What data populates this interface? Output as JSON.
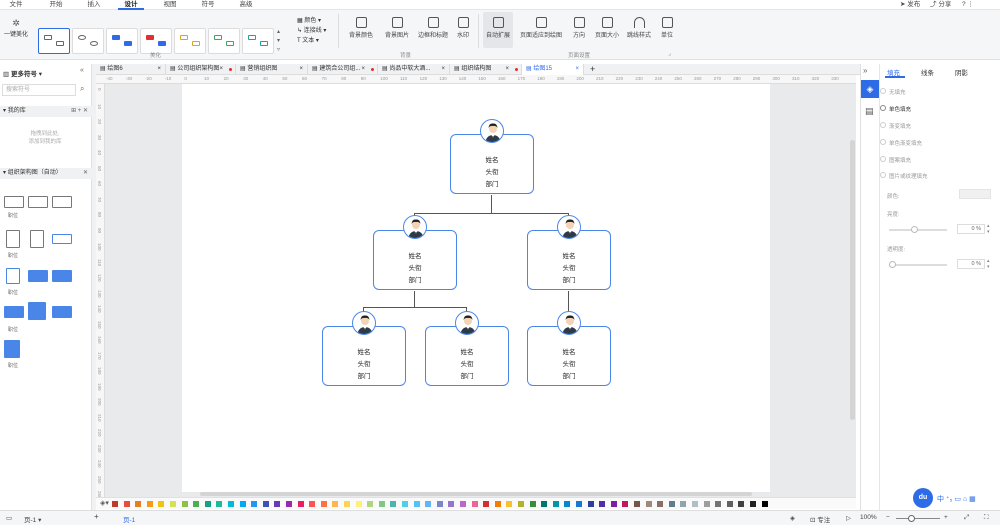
{
  "menubar": {
    "items": [
      "文件",
      "开始",
      "插入",
      "设计",
      "视图",
      "符号",
      "高级"
    ],
    "active_index": 3,
    "right": {
      "publish": "发布",
      "share": "分享",
      "help": "?"
    }
  },
  "ribbon": {
    "beautify_label": "一键美化",
    "group_beautify": "美化",
    "group_background": "背景",
    "group_page_setup": "页面设置",
    "color_label": "颜色",
    "connector_label": "连接线",
    "text_label": "文本",
    "buttons": [
      "背景颜色",
      "背景图片",
      "边框和标题",
      "水印",
      "自动扩展",
      "页面适应到绘图",
      "方向",
      "页面大小",
      "跳线样式",
      "单位"
    ]
  },
  "left_panel": {
    "title": "更多符号",
    "search_placeholder": "搜索符号",
    "my_library": "我的库",
    "drop_hint_line1": "拖拽到此处,",
    "drop_hint_line2": "添加到我的库",
    "org_section": "组织架构图（自动）",
    "shape_label": "职位"
  },
  "tabs": [
    {
      "label": "绘图6",
      "dot": false
    },
    {
      "label": "公司组织架构图",
      "dot": true
    },
    {
      "label": "营销组织图",
      "dot": false
    },
    {
      "label": "建筑合公司组...",
      "dot": true
    },
    {
      "label": "尚品中软大酒...",
      "dot": false
    },
    {
      "label": "组织结构图",
      "dot": true
    },
    {
      "label": "绘图15",
      "dot": false,
      "active": true
    }
  ],
  "ruler": {
    "h_ticks": [
      "-40",
      "-30",
      "-20",
      "-10",
      "0",
      "10",
      "20",
      "30",
      "40",
      "50",
      "60",
      "70",
      "80",
      "90",
      "100",
      "110",
      "120",
      "130",
      "140",
      "150",
      "160",
      "170",
      "180",
      "190",
      "200",
      "210",
      "220",
      "230",
      "240",
      "250",
      "260",
      "270",
      "280",
      "290",
      "300",
      "310",
      "320",
      "330"
    ],
    "v_ticks": [
      "0",
      "10",
      "20",
      "30",
      "40",
      "50",
      "60",
      "70",
      "80",
      "90",
      "100",
      "110",
      "120",
      "130",
      "140",
      "150",
      "160",
      "170",
      "180",
      "190",
      "200",
      "210",
      "220",
      "230",
      "240",
      "250",
      "260"
    ]
  },
  "org_cards": [
    {
      "name": "姓名",
      "title": "头衔",
      "dept": "部门"
    },
    {
      "name": "姓名",
      "title": "头衔",
      "dept": "部门"
    },
    {
      "name": "姓名",
      "title": "头衔",
      "dept": "部门"
    },
    {
      "name": "姓名",
      "title": "头衔",
      "dept": "部门"
    },
    {
      "name": "姓名",
      "title": "头衔",
      "dept": "部门"
    },
    {
      "name": "姓名",
      "title": "头衔",
      "dept": "部门"
    }
  ],
  "right_panel": {
    "tabs": [
      "填充",
      "线条",
      "阴影"
    ],
    "active_tab": 0,
    "fill_options": [
      "无填充",
      "单色填充",
      "渐变填充",
      "单色渐变填充",
      "图案填充",
      "图片或纹理填充"
    ],
    "color_label": "颜色:",
    "brightness_label": "亮度:",
    "brightness_value": "0 %",
    "transparency_label": "透明度:",
    "transparency_value": "0 %"
  },
  "palette": [
    "#c0392b",
    "#e74c3c",
    "#e67e22",
    "#f39c12",
    "#f1c40f",
    "#d4e157",
    "#8bc34a",
    "#4caf50",
    "#16a085",
    "#1abc9c",
    "#00bcd4",
    "#03a9f4",
    "#2196f3",
    "#3f51b5",
    "#673ab7",
    "#9c27b0",
    "#e91e63",
    "#ff5252",
    "#ff7043",
    "#ffb74d",
    "#ffd54f",
    "#fff176",
    "#aed581",
    "#81c784",
    "#4db6ac",
    "#4dd0e1",
    "#4fc3f7",
    "#64b5f6",
    "#7986cb",
    "#9575cd",
    "#ba68c8",
    "#f06292",
    "#d32f2f",
    "#f57c00",
    "#fbc02d",
    "#afb42b",
    "#388e3c",
    "#00796b",
    "#0097a7",
    "#0288d1",
    "#1976d2",
    "#303f9f",
    "#512da8",
    "#7b1fa2",
    "#c2185b",
    "#795548",
    "#a1887f",
    "#8d6e63",
    "#607d8b",
    "#90a4ae",
    "#b0bec5",
    "#9e9e9e",
    "#757575",
    "#616161",
    "#424242",
    "#212121",
    "#000000"
  ],
  "status": {
    "page_left": "页-1",
    "page_tab": "页-1",
    "focus": "专注",
    "zoom": "100%"
  }
}
